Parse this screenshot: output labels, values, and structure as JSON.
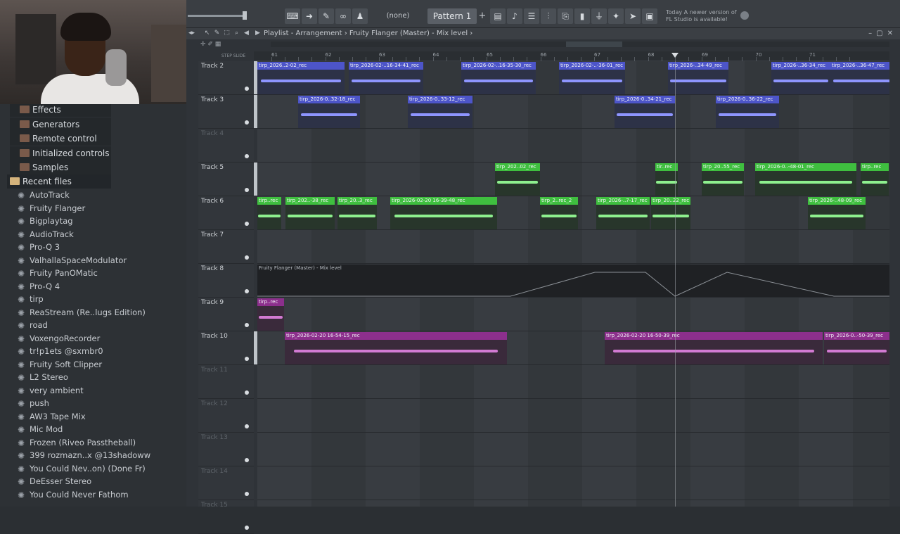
{
  "toolbar": {
    "pattern_none": "(none)",
    "pattern": "Pattern 1",
    "pattern_add": "+",
    "notice_line1": "Today  A newer version of",
    "notice_line2": "FL Studio is available!"
  },
  "playlist": {
    "title": "Playlist - Arrangement › Fruity Flanger (Master) - Mix level ›",
    "step_label": "STEP SLIDE"
  },
  "ruler": {
    "bars": [
      "61",
      "62",
      "63",
      "64",
      "65",
      "66",
      "67",
      "68",
      "69",
      "70",
      "71"
    ]
  },
  "browser": {
    "top_items": [
      {
        "label": "Effects"
      },
      {
        "label": "Generators"
      },
      {
        "label": "Remote control"
      },
      {
        "label": "Initialized controls"
      },
      {
        "label": "Samples"
      }
    ],
    "recent_label": "Recent files",
    "recent_items": [
      "AutoTrack",
      "Fruity Flanger",
      "Bigplaytag",
      "AudioTrack",
      "Pro-Q 3",
      "ValhallaSpaceModulator",
      "Fruity PanOMatic",
      "Pro-Q 4",
      "tirp",
      "ReaStream (Re..lugs Edition)",
      "road",
      "VoxengoRecorder",
      "tr!p1ets @sxmbr0",
      "Fruity Soft Clipper",
      "L2 Stereo",
      "very ambient",
      "push",
      "AW3 Tape Mix",
      "Mic Mod",
      "Frozen (Riveo Passtheball)",
      "399 rozmazn..x @13shadoww",
      "You Could Nev..on) (Done Fr)",
      "DeEsser Stereo",
      "You Could Never Fathom"
    ]
  },
  "tracks": [
    {
      "name": "Track 2",
      "dim": false,
      "strip": true
    },
    {
      "name": "Track 3",
      "dim": false,
      "strip": true
    },
    {
      "name": "Track 4",
      "dim": true,
      "strip": false
    },
    {
      "name": "Track 5",
      "dim": false,
      "strip": true
    },
    {
      "name": "Track 6",
      "dim": false,
      "strip": false
    },
    {
      "name": "Track 7",
      "dim": false,
      "strip": false
    },
    {
      "name": "Track 8",
      "dim": false,
      "strip": false
    },
    {
      "name": "Track 9",
      "dim": false,
      "strip": false
    },
    {
      "name": "Track 10",
      "dim": false,
      "strip": true
    },
    {
      "name": "Track 11",
      "dim": true,
      "strip": false
    },
    {
      "name": "Track 12",
      "dim": true,
      "strip": false
    },
    {
      "name": "Track 13",
      "dim": true,
      "strip": false
    },
    {
      "name": "Track 14",
      "dim": true,
      "strip": false
    },
    {
      "name": "Track 15",
      "dim": true,
      "strip": false
    }
  ],
  "clips": {
    "track2": [
      "tirp_2026..2-02_rec",
      "tirp_2026-02-..16-34-41_rec",
      "tirp_2026-02-..16-35-30_rec",
      "tirp_2026-02-..-36-01_rec",
      "tirp_2026-..34-49_rec",
      "tirp_2026-..36-34_rec",
      "tirp_2026-..36-47_rec"
    ],
    "track3": [
      "tirp_2026-0..32-18_rec",
      "tirp_2026-0..33-12_rec",
      "tirp_2026-0..34-21_rec",
      "tirp_2026-0..36-22_rec"
    ],
    "track5": [
      "tirp_202..02_rec",
      "tir..rec",
      "tirp_20..55_rec",
      "tirp_2026-0..-48-01_rec",
      "tirp..rec"
    ],
    "track6": [
      "tirp..rec",
      "tirp_202..-38_rec",
      "tirp_20..3_rec",
      "tirp_2026-02-20 16-39-48_rec",
      "tirp_2..rec_2",
      "tirp_2026-..7-17_rec",
      "tirp_20..22_rec",
      "tirp_2026-..48-09_rec"
    ],
    "track8": [
      "Fruity Flanger (Master) - Mix level"
    ],
    "track9": [
      "tirp..rec"
    ],
    "track10": [
      "tirp_2026-02-20 16-54-15_rec",
      "tirp_2026-02-20 16-50-39_rec",
      "tirp_2026-0..-50-39_rec"
    ]
  },
  "colors": {
    "blue": "#4d55c9",
    "green": "#3fbf3f",
    "purple": "#8c2f8c"
  }
}
